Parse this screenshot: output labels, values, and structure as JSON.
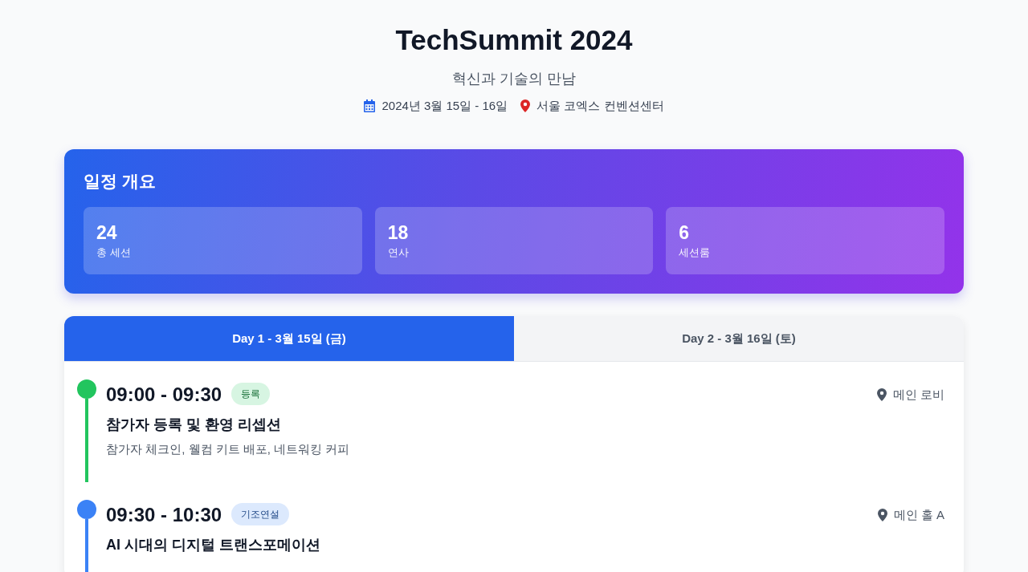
{
  "header": {
    "title": "TechSummit 2024",
    "subtitle": "혁신과 기술의 만남",
    "date": "2024년 3월 15일 - 16일",
    "venue": "서울 코엑스 컨벤션센터"
  },
  "overview": {
    "title": "일정 개요",
    "stats": [
      {
        "value": "24",
        "label": "총 세션"
      },
      {
        "value": "18",
        "label": "연사"
      },
      {
        "value": "6",
        "label": "세션룸"
      }
    ]
  },
  "tabs": [
    {
      "label": "Day 1 - 3월 15일 (금)",
      "selected": true
    },
    {
      "label": "Day 2 - 3월 16일 (토)",
      "selected": false
    }
  ],
  "sessions": [
    {
      "time": "09:00 - 09:30",
      "tag": "등록",
      "color": "#22c55e",
      "location": "메인 로비",
      "title": "참가자 등록 및 환영 리셉션",
      "description": "참가자 체크인, 웰컴 키트 배포, 네트워킹 커피"
    },
    {
      "time": "09:30 - 10:30",
      "tag": "기조연설",
      "color": "#3b82f6",
      "location": "메인 홀 A",
      "title": "AI 시대의 디지털 트랜스포메이션"
    }
  ]
}
